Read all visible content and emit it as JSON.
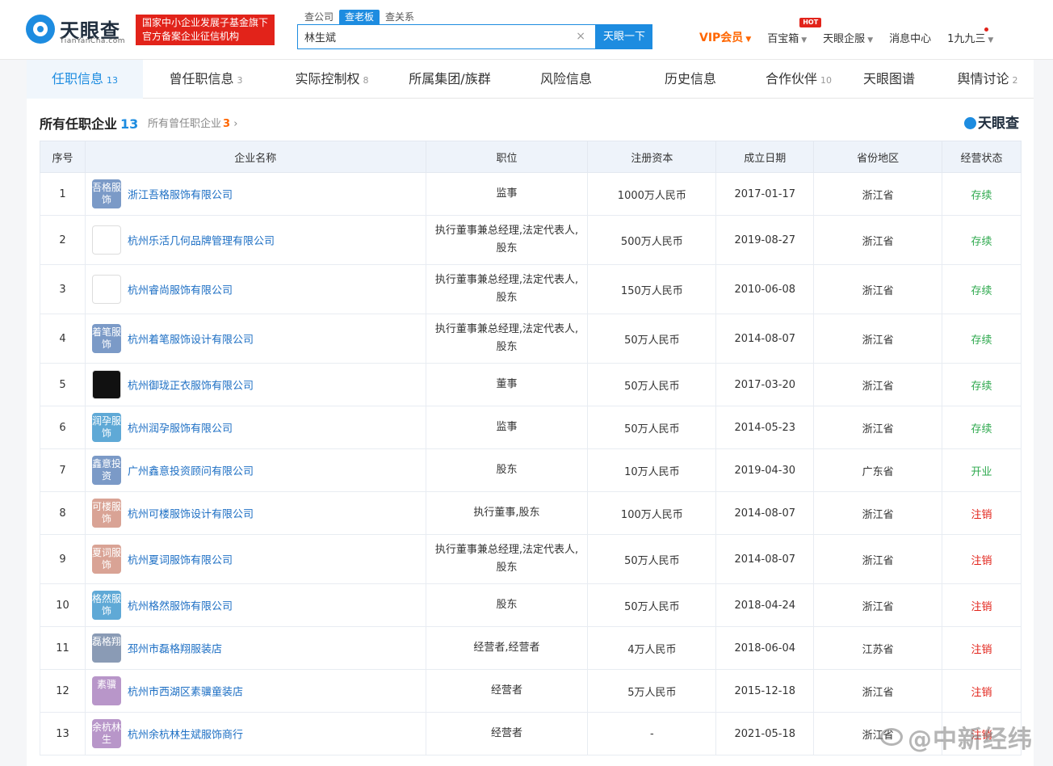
{
  "header": {
    "logo_text": "天眼查",
    "logo_sub": "TianYanCha.com",
    "slogan_line1": "国家中小企业发展子基金旗下",
    "slogan_line2": "官方备案企业征信机构",
    "search_tabs": [
      "查公司",
      "查老板",
      "查关系"
    ],
    "search_value": "林生斌",
    "search_button": "天眼一下",
    "nav": {
      "vip": "VIP会员",
      "treasure": "百宝箱",
      "hot": "HOT",
      "enterprise": "天眼企服",
      "messages": "消息中心",
      "user": "1九九三"
    }
  },
  "tabs": [
    {
      "label": "任职信息",
      "count": "13"
    },
    {
      "label": "曾任职信息",
      "count": "3"
    },
    {
      "label": "实际控制权",
      "count": "8"
    },
    {
      "label": "所属集团/族群",
      "count": ""
    },
    {
      "label": "风险信息",
      "count": ""
    },
    {
      "label": "历史信息",
      "count": ""
    },
    {
      "label": "合作伙伴",
      "count": "10"
    },
    {
      "label": "天眼图谱",
      "count": ""
    },
    {
      "label": "舆情讨论",
      "count": "2"
    }
  ],
  "section": {
    "title": "所有任职企业",
    "count": "13",
    "link_label": "所有曾任职企业",
    "link_count": "3",
    "brand": "天眼查"
  },
  "table": {
    "headers": [
      "序号",
      "企业名称",
      "职位",
      "注册资本",
      "成立日期",
      "省份地区",
      "经营状态"
    ],
    "rows": [
      {
        "no": "1",
        "logo": "吾格服饰",
        "logo_color": "#7b9ac7",
        "name": "浙江吾格服饰有限公司",
        "position": "监事",
        "capital": "1000万人民币",
        "date": "2017-01-17",
        "region": "浙江省",
        "status": "存续"
      },
      {
        "no": "2",
        "logo": "",
        "logo_color": "#ffffff",
        "name": "杭州乐活几何品牌管理有限公司",
        "position": "执行董事兼总经理,法定代表人,股东",
        "capital": "500万人民币",
        "date": "2019-08-27",
        "region": "浙江省",
        "status": "存续"
      },
      {
        "no": "3",
        "logo": "",
        "logo_color": "#ffffff",
        "name": "杭州睿尚服饰有限公司",
        "position": "执行董事兼总经理,法定代表人,股东",
        "capital": "150万人民币",
        "date": "2010-06-08",
        "region": "浙江省",
        "status": "存续"
      },
      {
        "no": "4",
        "logo": "着笔服饰",
        "logo_color": "#7b9ac7",
        "name": "杭州着笔服饰设计有限公司",
        "position": "执行董事兼总经理,法定代表人,股东",
        "capital": "50万人民币",
        "date": "2014-08-07",
        "region": "浙江省",
        "status": "存续"
      },
      {
        "no": "5",
        "logo": "",
        "logo_color": "#111111",
        "name": "杭州御珑正衣服饰有限公司",
        "position": "董事",
        "capital": "50万人民币",
        "date": "2017-03-20",
        "region": "浙江省",
        "status": "存续"
      },
      {
        "no": "6",
        "logo": "润孕服饰",
        "logo_color": "#5fa9d6",
        "name": "杭州润孕服饰有限公司",
        "position": "监事",
        "capital": "50万人民币",
        "date": "2014-05-23",
        "region": "浙江省",
        "status": "存续"
      },
      {
        "no": "7",
        "logo": "鑫意投资",
        "logo_color": "#7b9ac7",
        "name": "广州鑫意投资顾问有限公司",
        "position": "股东",
        "capital": "10万人民币",
        "date": "2019-04-30",
        "region": "广东省",
        "status": "开业"
      },
      {
        "no": "8",
        "logo": "可楼服饰",
        "logo_color": "#d9a395",
        "name": "杭州可楼服饰设计有限公司",
        "position": "执行董事,股东",
        "capital": "100万人民币",
        "date": "2014-08-07",
        "region": "浙江省",
        "status": "注销"
      },
      {
        "no": "9",
        "logo": "夏词服饰",
        "logo_color": "#d9a395",
        "name": "杭州夏词服饰有限公司",
        "position": "执行董事兼总经理,法定代表人,股东",
        "capital": "50万人民币",
        "date": "2014-08-07",
        "region": "浙江省",
        "status": "注销"
      },
      {
        "no": "10",
        "logo": "格然服饰",
        "logo_color": "#5fa9d6",
        "name": "杭州格然服饰有限公司",
        "position": "股东",
        "capital": "50万人民币",
        "date": "2018-04-24",
        "region": "浙江省",
        "status": "注销"
      },
      {
        "no": "11",
        "logo": "磊格翔",
        "logo_color": "#8a9bb5",
        "name": "邳州市磊格翔服装店",
        "position": "经营者,经营者",
        "capital": "4万人民币",
        "date": "2018-06-04",
        "region": "江苏省",
        "status": "注销"
      },
      {
        "no": "12",
        "logo": "素骥",
        "logo_color": "#b896c9",
        "name": "杭州市西湖区素骥童装店",
        "position": "经营者",
        "capital": "5万人民币",
        "date": "2015-12-18",
        "region": "浙江省",
        "status": "注销"
      },
      {
        "no": "13",
        "logo": "余杭林生",
        "logo_color": "#b896c9",
        "name": "杭州余杭林生斌服饰商行",
        "position": "经营者",
        "capital": "-",
        "date": "2021-05-18",
        "region": "浙江省",
        "status": "注销"
      }
    ]
  },
  "overlay": {
    "weibo_watermark": "@中新经纬"
  }
}
